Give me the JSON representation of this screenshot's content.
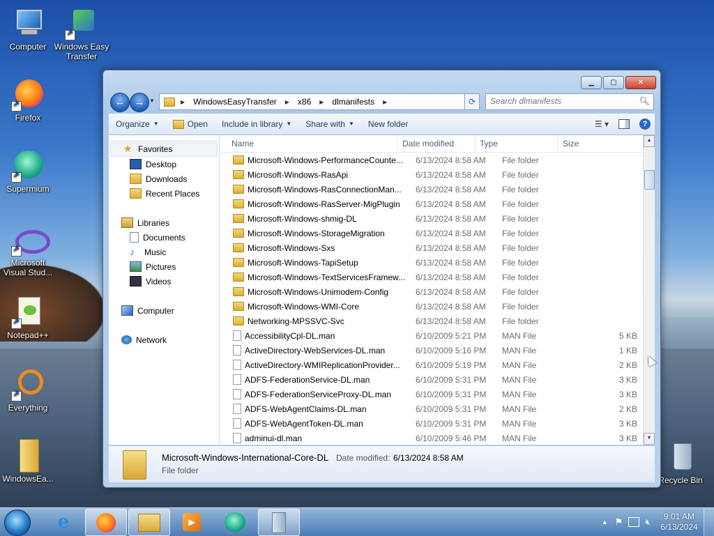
{
  "desktop": {
    "icons": [
      {
        "label": "Computer"
      },
      {
        "label": "Windows Easy Transfer"
      },
      {
        "label": "Firefox"
      },
      {
        "label": "Supermium"
      },
      {
        "label": "Microsoft Visual Stud..."
      },
      {
        "label": "Notepad++"
      },
      {
        "label": "Everything"
      },
      {
        "label": "WindowsEa..."
      },
      {
        "label": "Recycle Bin"
      }
    ]
  },
  "window": {
    "address": [
      "WindowsEasyTransfer",
      "x86",
      "dlmanifests"
    ],
    "search_placeholder": "Search dlmanifests",
    "commands": {
      "organize": "Organize",
      "open": "Open",
      "include": "Include in library",
      "share": "Share with",
      "newfolder": "New folder"
    },
    "nav": {
      "favorites": "Favorites",
      "desktop": "Desktop",
      "downloads": "Downloads",
      "recent": "Recent Places",
      "libraries": "Libraries",
      "documents": "Documents",
      "music": "Music",
      "pictures": "Pictures",
      "videos": "Videos",
      "computer": "Computer",
      "network": "Network"
    },
    "columns": {
      "name": "Name",
      "date": "Date modified",
      "type": "Type",
      "size": "Size"
    },
    "rows": [
      {
        "name": "Microsoft-Windows-PerformanceCounte...",
        "date": "6/13/2024 8:58 AM",
        "type": "File folder",
        "size": ""
      },
      {
        "name": "Microsoft-Windows-RasApi",
        "date": "6/13/2024 8:58 AM",
        "type": "File folder",
        "size": ""
      },
      {
        "name": "Microsoft-Windows-RasConnectionMan...",
        "date": "6/13/2024 8:58 AM",
        "type": "File folder",
        "size": ""
      },
      {
        "name": "Microsoft-Windows-RasServer-MigPlugin",
        "date": "6/13/2024 8:58 AM",
        "type": "File folder",
        "size": ""
      },
      {
        "name": "Microsoft-Windows-shmig-DL",
        "date": "6/13/2024 8:58 AM",
        "type": "File folder",
        "size": ""
      },
      {
        "name": "Microsoft-Windows-StorageMigration",
        "date": "6/13/2024 8:58 AM",
        "type": "File folder",
        "size": ""
      },
      {
        "name": "Microsoft-Windows-Sxs",
        "date": "6/13/2024 8:58 AM",
        "type": "File folder",
        "size": ""
      },
      {
        "name": "Microsoft-Windows-TapiSetup",
        "date": "6/13/2024 8:58 AM",
        "type": "File folder",
        "size": ""
      },
      {
        "name": "Microsoft-Windows-TextServicesFramew...",
        "date": "6/13/2024 8:58 AM",
        "type": "File folder",
        "size": ""
      },
      {
        "name": "Microsoft-Windows-Unimodem-Config",
        "date": "6/13/2024 8:58 AM",
        "type": "File folder",
        "size": ""
      },
      {
        "name": "Microsoft-Windows-WMI-Core",
        "date": "6/13/2024 8:58 AM",
        "type": "File folder",
        "size": ""
      },
      {
        "name": "Networking-MPSSVC-Svc",
        "date": "6/13/2024 8:58 AM",
        "type": "File folder",
        "size": ""
      },
      {
        "name": "AccessibilityCpl-DL.man",
        "date": "6/10/2009 5:21 PM",
        "type": "MAN File",
        "size": "5 KB"
      },
      {
        "name": "ActiveDirectory-WebServices-DL.man",
        "date": "6/10/2009 5:16 PM",
        "type": "MAN File",
        "size": "1 KB"
      },
      {
        "name": "ActiveDirectory-WMIReplicationProvider...",
        "date": "6/10/2009 5:19 PM",
        "type": "MAN File",
        "size": "2 KB"
      },
      {
        "name": "ADFS-FederationService-DL.man",
        "date": "6/10/2009 5:31 PM",
        "type": "MAN File",
        "size": "3 KB"
      },
      {
        "name": "ADFS-FederationServiceProxy-DL.man",
        "date": "6/10/2009 5:31 PM",
        "type": "MAN File",
        "size": "3 KB"
      },
      {
        "name": "ADFS-WebAgentClaims-DL.man",
        "date": "6/10/2009 5:31 PM",
        "type": "MAN File",
        "size": "2 KB"
      },
      {
        "name": "ADFS-WebAgentToken-DL.man",
        "date": "6/10/2009 5:31 PM",
        "type": "MAN File",
        "size": "3 KB"
      },
      {
        "name": "adminui-dl.man",
        "date": "6/10/2009 5:46 PM",
        "type": "MAN File",
        "size": "3 KB"
      }
    ],
    "details": {
      "name": "Microsoft-Windows-International-Core-DL",
      "date_label": "Date modified:",
      "date_value": "6/13/2024 8:58 AM",
      "type": "File folder"
    }
  },
  "taskbar": {
    "time": "9:01 AM",
    "date": "6/13/2024"
  }
}
